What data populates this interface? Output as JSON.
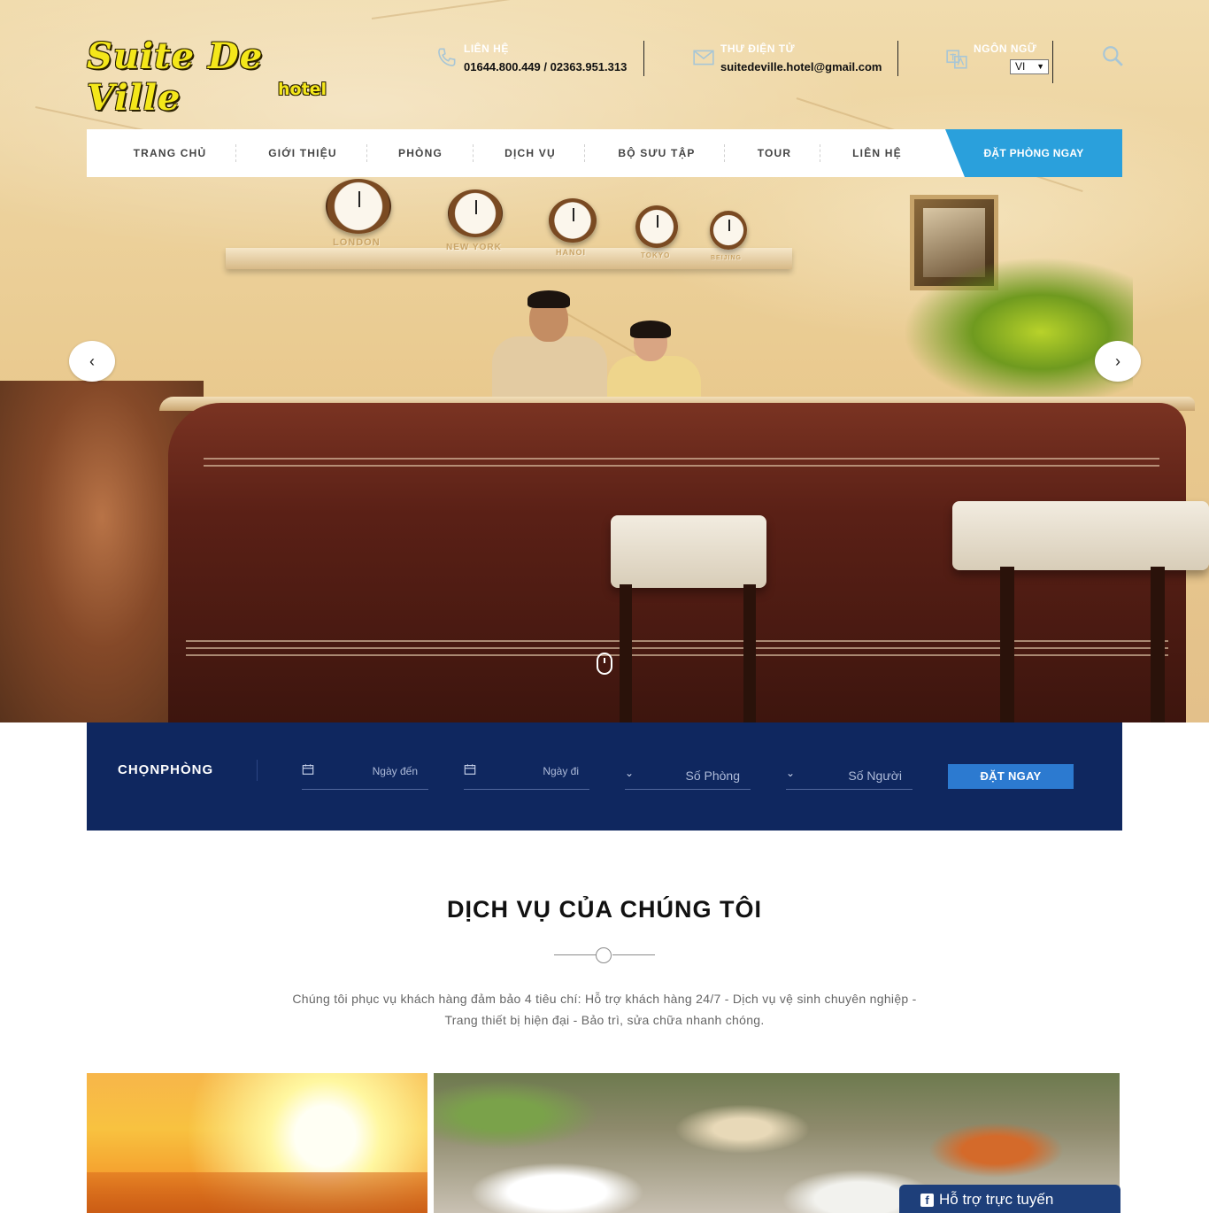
{
  "logo": {
    "main": "Suite De Ville",
    "sub": "hotel"
  },
  "header": {
    "contact": {
      "label": "LIÊN HỆ",
      "value": "01644.800.449 / 02363.951.313",
      "icon": "phone-icon"
    },
    "email": {
      "label": "THƯ ĐIỆN TỬ",
      "value": "suitedeville.hotel@gmail.com",
      "icon": "mail-icon"
    },
    "language": {
      "label": "NGÔN NGỮ",
      "selected": "VI",
      "icon": "translate-icon"
    },
    "search_icon": "search-icon"
  },
  "nav": {
    "items": [
      "TRANG CHỦ",
      "GIỚI THIỆU",
      "PHÒNG",
      "DỊCH VỤ",
      "BỘ SƯU TẬP",
      "TOUR",
      "LIÊN HỆ"
    ],
    "cta": "ĐẶT PHÒNG NGAY"
  },
  "hero": {
    "prev_glyph": "‹",
    "next_glyph": "›",
    "clocks": [
      "LONDON",
      "NEW YORK",
      "HANOI",
      "TOKYO",
      "BEIJING"
    ]
  },
  "booking": {
    "title": "CHỌNPHÒNG",
    "arrival_placeholder": "Ngày đến",
    "departure_placeholder": "Ngày đi",
    "rooms_placeholder": "Số Phòng",
    "guests_placeholder": "Số Người",
    "submit_label": "ĐẶT NGAY"
  },
  "services": {
    "title": "DỊCH VỤ CỦA CHÚNG TÔI",
    "description": "Chúng tôi phục vụ khách hàng đảm bảo 4 tiêu chí: Hỗ trợ khách hàng 24/7 - Dịch vụ vệ sinh chuyên nghiệp - Trang thiết bị hiện đại - Bảo trì, sửa chữa nhanh chóng."
  },
  "support": {
    "label": "Hỗ trợ trực tuyến",
    "icon": "facebook-icon"
  },
  "colors": {
    "nav_cta": "#2aa0dc",
    "booking_bg": "#0f275f",
    "booking_button": "#2c7ad0",
    "support_bg": "#1e3f7a",
    "logo_yellow": "#f4e71a"
  }
}
